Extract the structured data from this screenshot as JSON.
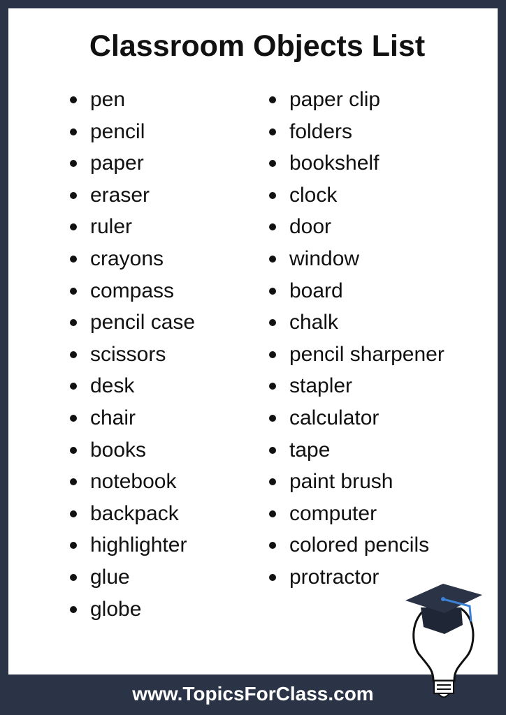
{
  "title": "Classroom Objects List",
  "left_items": [
    "pen",
    "pencil",
    "paper",
    "eraser",
    "ruler",
    "crayons",
    "compass",
    "pencil case",
    "scissors",
    "desk",
    "chair",
    "books",
    "notebook",
    "backpack",
    "highlighter",
    "glue",
    "globe"
  ],
  "right_items": [
    "paper clip",
    "folders",
    "bookshelf",
    "clock",
    "door",
    "window",
    "board",
    "chalk",
    "pencil sharpener",
    "stapler",
    "calculator",
    "tape",
    "paint brush",
    "computer",
    "colored pencils",
    "protractor"
  ],
  "footer": "www.TopicsForClass.com",
  "logo": {
    "icon": "lightbulb-graduation-cap-icon"
  },
  "colors": {
    "background": "#2b3447",
    "accent": "#3b82d6"
  }
}
